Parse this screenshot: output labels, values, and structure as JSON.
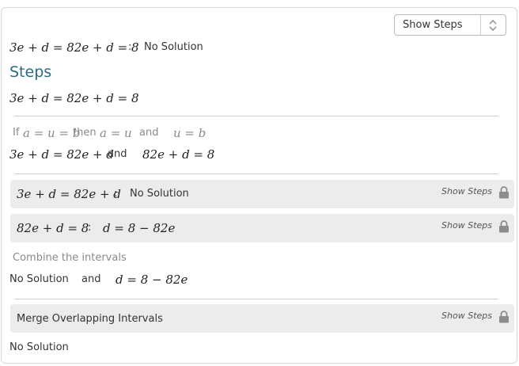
{
  "header": {
    "select_label": "Show Steps",
    "equation": "3e + d = 82e + d = 8",
    "colon": ":",
    "result": "No Solution"
  },
  "steps_title": "Steps",
  "equation_line": "3e + d = 82e + d = 8",
  "rule_hint": {
    "if": "If",
    "expr1": "a = u = b",
    "then": "then",
    "expr2": "a = u",
    "and": "and",
    "expr3": "u = b"
  },
  "split_line": {
    "left": "3e + d = 82e + d",
    "and": "and",
    "right": "82e + d = 8"
  },
  "box1": {
    "equation": "3e + d = 82e + d",
    "colon": ":",
    "result": "No Solution",
    "link": "Show Steps"
  },
  "box2": {
    "equation": "82e + d = 8",
    "colon": ":",
    "result": "d = 8 − 82e",
    "link": "Show Steps"
  },
  "combine_label": "Combine the intervals",
  "combine_line": {
    "left": "No Solution",
    "and": "and",
    "right": "d = 8 − 82e"
  },
  "box3": {
    "label": "Merge Overlapping Intervals",
    "link": "Show Steps"
  },
  "final_result": "No Solution",
  "icons": {
    "select_arrows": "updown-arrows-icon",
    "lock": "lock-icon"
  },
  "colors": {
    "title": "#2b6b83",
    "box_bg": "#ececec",
    "muted": "#8a8a8a"
  }
}
